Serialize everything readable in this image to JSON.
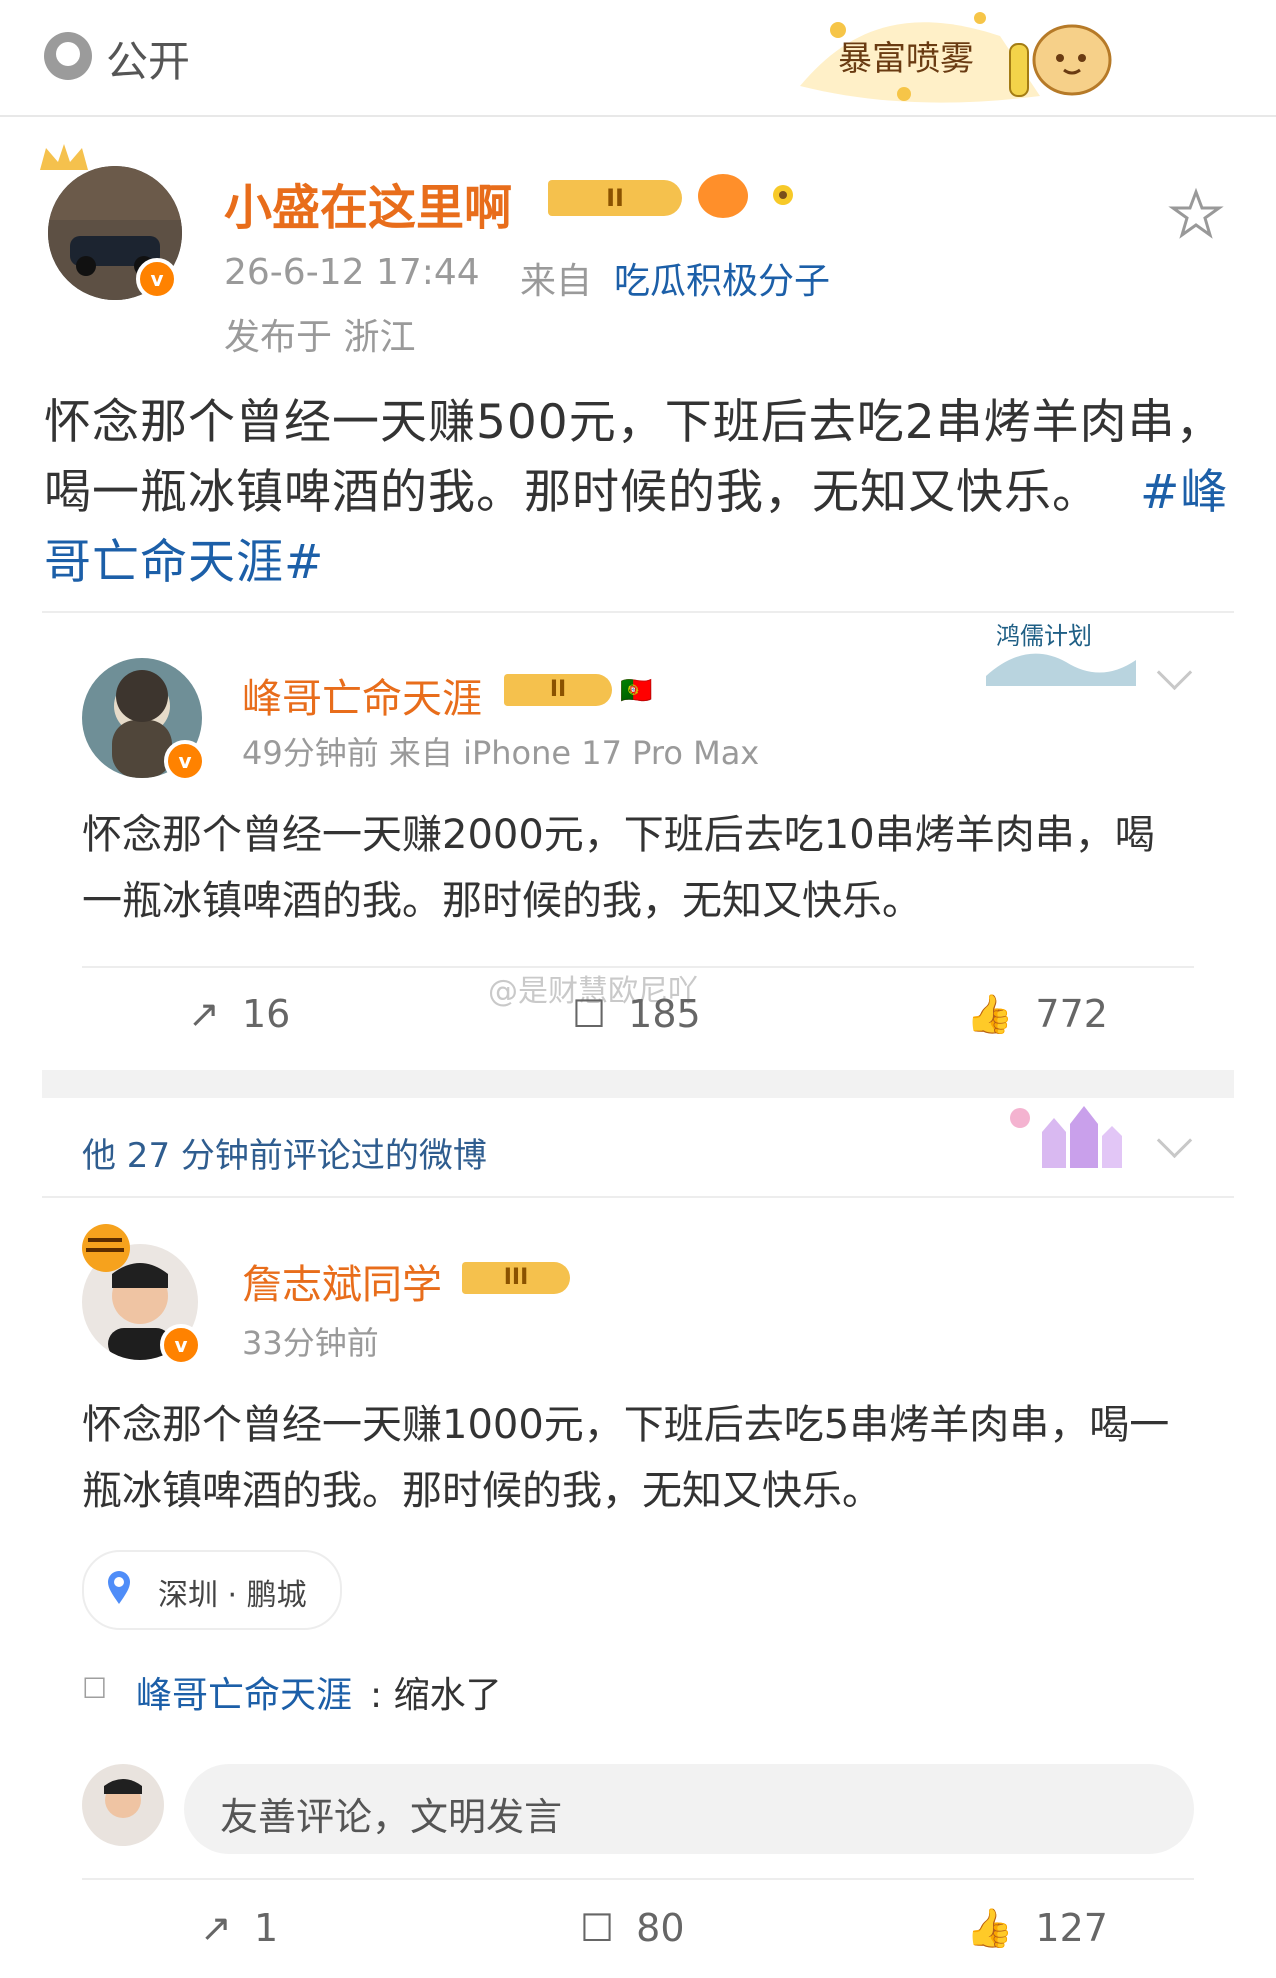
{
  "topbar": {
    "visibility_label": "公开",
    "banner_text": "暴富喷雾"
  },
  "post": {
    "author_name": "小盛在这里啊",
    "badge_level": "II",
    "timestamp": "26-6-12 17:44",
    "source_prefix": "来自",
    "source_name": "吃瓜积极分子",
    "location_label": "发布于 浙江",
    "content": "怀念那个曾经一天赚500元，下班后去吃2串烤羊肉串，喝一瓶冰镇啤酒的我。那时候的我，无知又快乐。",
    "hashtag": "#峰哥亡命天涯#"
  },
  "repost": {
    "author_name": "峰哥亡命天涯",
    "badge_level": "II",
    "flag": "🇵🇹",
    "banner_text": "鸿儒计划",
    "meta": "49分钟前  来自 iPhone 17 Pro Max",
    "content": "怀念那个曾经一天赚2000元，下班后去吃10串烤羊肉串，喝一瓶冰镇啤酒的我。那时候的我，无知又快乐。",
    "watermark": "@是财慧欧尼吖",
    "share_count": "16",
    "comment_count": "185",
    "like_count": "772"
  },
  "section": {
    "title": "他 27 分钟前评论过的微博"
  },
  "comment_post": {
    "author_name": "詹志斌同学",
    "badge_level": "III",
    "time": "33分钟前",
    "content": "怀念那个曾经一天赚1000元，下班后去吃5串烤羊肉串，喝一瓶冰镇啤酒的我。那时候的我，无知又快乐。",
    "location": "深圳 · 鹏城",
    "reply_author": "峰哥亡命天涯",
    "reply_text": ": 缩水了",
    "input_placeholder": "友善评论，文明发言",
    "share_count": "1",
    "comment_count": "80",
    "like_count": "127"
  },
  "colors": {
    "accent": "#e86d1b",
    "link": "#1c5fa8",
    "verified": "#ff8200",
    "badge_gold": "#f5c14d"
  }
}
